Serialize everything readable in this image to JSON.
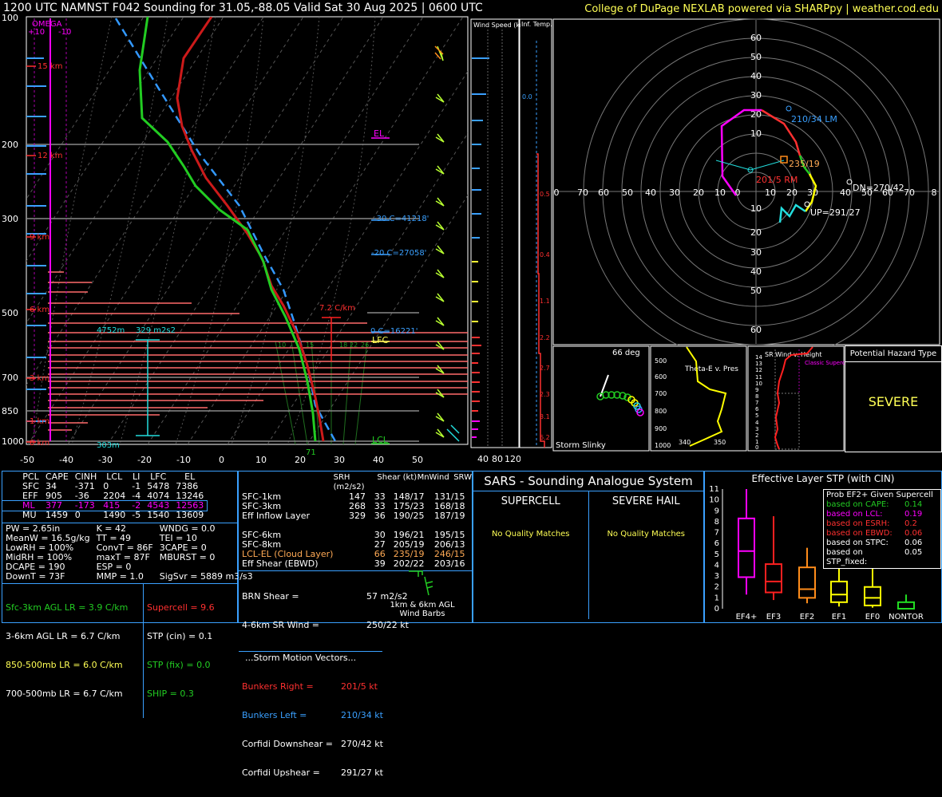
{
  "header": {
    "title": "1200 UTC NAMNST F042 Sounding for 31.05,-88.05 Valid  Sat 30 Aug 2025 | 0600 UTC",
    "credit": "College of DuPage NEXLAB powered via SHARPpy | weather.cod.edu"
  },
  "colors": {
    "temp": "#cc1a1a",
    "dewpoint": "#22cc22",
    "wetbulb": "#3399ff",
    "accent": "#ffff55",
    "panel_border": "#3aa0ff"
  },
  "skewt": {
    "pressure_labels": [
      "100",
      "200",
      "300",
      "500",
      "700",
      "850",
      "1000"
    ],
    "temp_labels": [
      "-50",
      "-40",
      "-30",
      "-20",
      "-10",
      "0",
      "10",
      "20",
      "30",
      "40",
      "50"
    ],
    "height_labels": [
      "15 km",
      "12 km",
      "9 km",
      "6 km",
      "3 km",
      "1 km",
      "0 km"
    ],
    "omega_title": "OMEGA",
    "omega_scale": [
      "+10",
      "-10"
    ],
    "annotations": {
      "el": "EL",
      "m30": "-30 C=41218'",
      "m20": "-20 C=27058'",
      "zero": "0 C=16221'",
      "lfc": "LFC",
      "lcl": "LCL",
      "lapse": "7.2 C/km",
      "depth": "4752m",
      "srh": "329 m2s2",
      "bottom": "303m",
      "sfc_temp": "71"
    },
    "theta_labels": [
      "10",
      "15",
      "18",
      "22",
      "26"
    ]
  },
  "wind_speed": {
    "title": "Wind Speed (knots)",
    "axis": [
      "40",
      "80",
      "120"
    ]
  },
  "temp_adv": {
    "title": "Inf. Temp. Adv.(C/hr)",
    "values": [
      "0.0",
      "0.5",
      "0.4",
      "1.1",
      "2.2",
      "2.7",
      "2.3",
      "3.1",
      "6.2"
    ]
  },
  "hodograph": {
    "ring_labels_up": [
      "60",
      "50",
      "40",
      "30",
      "20",
      "10"
    ],
    "ring_labels_down": [
      "10",
      "20",
      "30",
      "40",
      "50",
      "60"
    ],
    "ring_labels_x": [
      "0",
      "70",
      "60",
      "50",
      "40",
      "30",
      "20",
      "10",
      "0",
      "10",
      "20",
      "30",
      "40",
      "50",
      "60",
      "70",
      "8"
    ],
    "lm": "210/34 LM",
    "rm": "201/5 RM",
    "mean": "235/19",
    "dn": "DN=270/42",
    "up": "UP=291/27"
  },
  "slinky": {
    "title": "Storm Slinky",
    "angle": "66 deg"
  },
  "theta_e": {
    "title": "Theta-E v. Pres",
    "y": [
      "500",
      "600",
      "700",
      "800",
      "900",
      "1000"
    ],
    "x": [
      "340",
      "350"
    ]
  },
  "sr_wind": {
    "title": "SR Wind v. Height",
    "y": [
      "14",
      "13",
      "12",
      "11",
      "10",
      "9",
      "8",
      "7",
      "6",
      "5",
      "4",
      "3",
      "2",
      "1",
      "0"
    ],
    "x": [
      "0",
      "20",
      "40",
      "60",
      "80"
    ],
    "classic": "Classic Supercell"
  },
  "hazard": {
    "title": "Potential Hazard Type",
    "value": "SEVERE"
  },
  "indices": {
    "headers": [
      "PCL",
      "CAPE",
      "CINH",
      "LCL",
      "LI",
      "LFC",
      "EL"
    ],
    "rows": [
      [
        "SFC",
        "34",
        "-371",
        "0",
        "-1",
        "5478",
        "7386"
      ],
      [
        "EFF",
        "905",
        "-36",
        "2204",
        "-4",
        "4074",
        "13246"
      ],
      [
        "ML",
        "377",
        "-173",
        "415",
        "-2",
        "4543",
        "12563"
      ],
      [
        "MU",
        "1459",
        "0",
        "1490",
        "-5",
        "1540",
        "13609"
      ]
    ],
    "misc": [
      [
        "PW = 2.65in",
        "K = 42",
        "WNDG = 0.0"
      ],
      [
        "MeanW = 16.5g/kg",
        "TT = 49",
        "TEI = 10"
      ],
      [
        "LowRH = 100%",
        "ConvT = 86F",
        "3CAPE = 0"
      ],
      [
        "MidRH = 100%",
        "maxT = 87F",
        "MBURST = 0"
      ],
      [
        "DCAPE = 190",
        "ESP = 0",
        ""
      ],
      [
        "DownT = 73F",
        "MMP = 1.0",
        "SigSvr = 5889 m3/s3"
      ]
    ],
    "lapse": [
      "Sfc-3km AGL LR = 3.9 C/km",
      "3-6km AGL LR = 6.7 C/km",
      "850-500mb LR = 6.0 C/km",
      "700-500mb LR = 6.7 C/km"
    ],
    "params": [
      "Supercell = 9.6",
      "STP (cin) = 0.1",
      "STP (fix) = 0.0",
      "SHIP = 0.3"
    ]
  },
  "kinematics": {
    "headers": [
      "SRH (m2/s2)",
      "Shear (kt)",
      "MnWind",
      "SRW"
    ],
    "rows": [
      [
        "SFC-1km",
        "147",
        "33",
        "148/17",
        "131/15"
      ],
      [
        "SFC-3km",
        "268",
        "33",
        "175/23",
        "168/18"
      ],
      [
        "Eff Inflow Layer",
        "329",
        "36",
        "190/25",
        "187/19"
      ],
      [
        "",
        "",
        "",
        "",
        ""
      ],
      [
        "SFC-6km",
        "",
        "30",
        "196/21",
        "195/15"
      ],
      [
        "SFC-8km",
        "",
        "27",
        "205/19",
        "206/13"
      ],
      [
        "LCL-EL (Cloud Layer)",
        "",
        "66",
        "235/19",
        "246/15"
      ],
      [
        "Eff Shear (EBWD)",
        "",
        "39",
        "202/22",
        "203/16"
      ]
    ],
    "brn": [
      "BRN Shear =",
      "57 m2/s2"
    ],
    "srwind46": [
      "4-6km SR Wind =",
      "250/22 kt"
    ],
    "storm_title": "...Storm Motion Vectors...",
    "storm": [
      [
        "Bunkers Right =",
        "201/5 kt"
      ],
      [
        "Bunkers Left =",
        "210/34 kt"
      ],
      [
        "Corfidi Downshear =",
        "270/42 kt"
      ],
      [
        "Corfidi Upshear =",
        "291/27 kt"
      ]
    ],
    "barb_label": "1km & 6km AGL Wind Barbs"
  },
  "sars": {
    "title": "SARS - Sounding Analogue System",
    "supercell": "SUPERCELL",
    "hail": "SEVERE HAIL",
    "sc_msg": "No Quality Matches",
    "hail_msg": "No Quality Matches"
  },
  "stp": {
    "title": "Effective Layer STP (with CIN)",
    "y_labels": [
      "11",
      "10",
      "9",
      "8",
      "7",
      "6",
      "5",
      "4",
      "3",
      "2",
      "1",
      "0"
    ],
    "categories": [
      "EF4+",
      "EF3",
      "EF2",
      "EF1",
      "EF0",
      "NONTOR"
    ],
    "legend_title": "Prob EF2+ Given Supercell",
    "legend": [
      [
        "based on CAPE:",
        "0.14"
      ],
      [
        "based on LCL:",
        "0.19"
      ],
      [
        "based on ESRH:",
        "0.2"
      ],
      [
        "based on EBWD:",
        "0.06"
      ],
      [
        "based on STPC:",
        "0.06"
      ],
      [
        "based on STP_fixed:",
        "0.05"
      ]
    ]
  },
  "chart_data": {
    "type": "box",
    "title": "Effective Layer STP (with CIN)",
    "categories": [
      "EF4+",
      "EF3",
      "EF2",
      "EF1",
      "EF0",
      "NONTOR"
    ],
    "ylim": [
      0,
      11
    ],
    "boxes": [
      {
        "low": 1.3,
        "q1": 2.9,
        "median": 5.3,
        "q3": 8.3,
        "high": 11
      },
      {
        "low": 0.8,
        "q1": 1.5,
        "median": 2.5,
        "q3": 4.1,
        "high": 8.5
      },
      {
        "low": 0.5,
        "q1": 1.0,
        "median": 1.8,
        "q3": 3.8,
        "high": 5.6
      },
      {
        "low": 0.2,
        "q1": 0.6,
        "median": 1.3,
        "q3": 2.5,
        "high": 4.5
      },
      {
        "low": 0.1,
        "q1": 0.3,
        "median": 1.0,
        "q3": 2.0,
        "high": 3.8
      },
      {
        "low": 0.0,
        "q1": 0.0,
        "median": 0.0,
        "q3": 0.6,
        "high": 1.3
      }
    ],
    "box_colors": [
      "#ff00ff",
      "#ff2020",
      "#ff8c1a",
      "#ffff00",
      "#ffff00",
      "#22dd22"
    ]
  }
}
